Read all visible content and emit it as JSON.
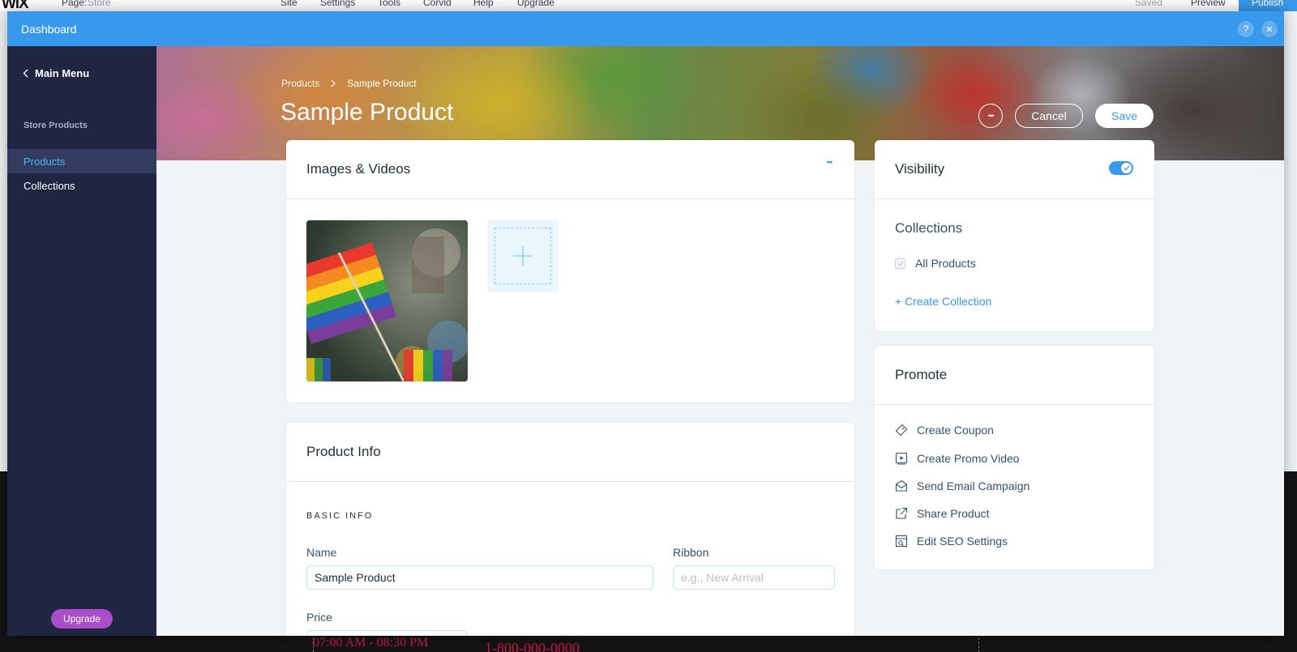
{
  "editor": {
    "logo": "WiX",
    "page_label": "Page:",
    "page_value": "Store",
    "menu": [
      "Site",
      "Settings",
      "Tools",
      "Corvid",
      "Help",
      "Upgrade"
    ],
    "saved_label": "Saved",
    "preview_label": "Preview",
    "publish_label": "Publish",
    "bg_hours": "07:00 AM - 08:30 PM",
    "bg_phone": "1-800-000-0000"
  },
  "modal": {
    "title": "Dashboard",
    "help_icon": "?",
    "close_icon": "✕"
  },
  "sidebar": {
    "main_menu": "Main Menu",
    "section": "Store Products",
    "items": [
      {
        "label": "Products",
        "active": true
      },
      {
        "label": "Collections",
        "active": false
      }
    ],
    "upgrade": "Upgrade"
  },
  "header": {
    "breadcrumb_parent": "Products",
    "breadcrumb_current": "Sample Product",
    "title": "Sample Product",
    "more": "•••",
    "cancel": "Cancel",
    "save": "Save"
  },
  "media": {
    "title": "Images & Videos",
    "more": "•••"
  },
  "product_info": {
    "title": "Product Info",
    "section": "BASIC INFO",
    "name_label": "Name",
    "name_value": "Sample Product",
    "ribbon_label": "Ribbon",
    "ribbon_placeholder": "e.g., New Arrival",
    "price_label": "Price"
  },
  "visibility": {
    "title": "Visibility",
    "enabled": true
  },
  "collections": {
    "title": "Collections",
    "items": [
      {
        "label": "All Products",
        "checked": true
      }
    ],
    "create_link": "+ Create Collection"
  },
  "promote": {
    "title": "Promote",
    "items": [
      {
        "label": "Create Coupon",
        "icon": "coupon-icon"
      },
      {
        "label": "Create Promo Video",
        "icon": "video-icon"
      },
      {
        "label": "Send Email Campaign",
        "icon": "email-icon"
      },
      {
        "label": "Share Product",
        "icon": "share-icon"
      },
      {
        "label": "Edit SEO Settings",
        "icon": "seo-icon"
      }
    ]
  },
  "colors": {
    "accent": "#3899ec",
    "sidebar": "#202542",
    "upgrade": "#aa4dc8"
  }
}
